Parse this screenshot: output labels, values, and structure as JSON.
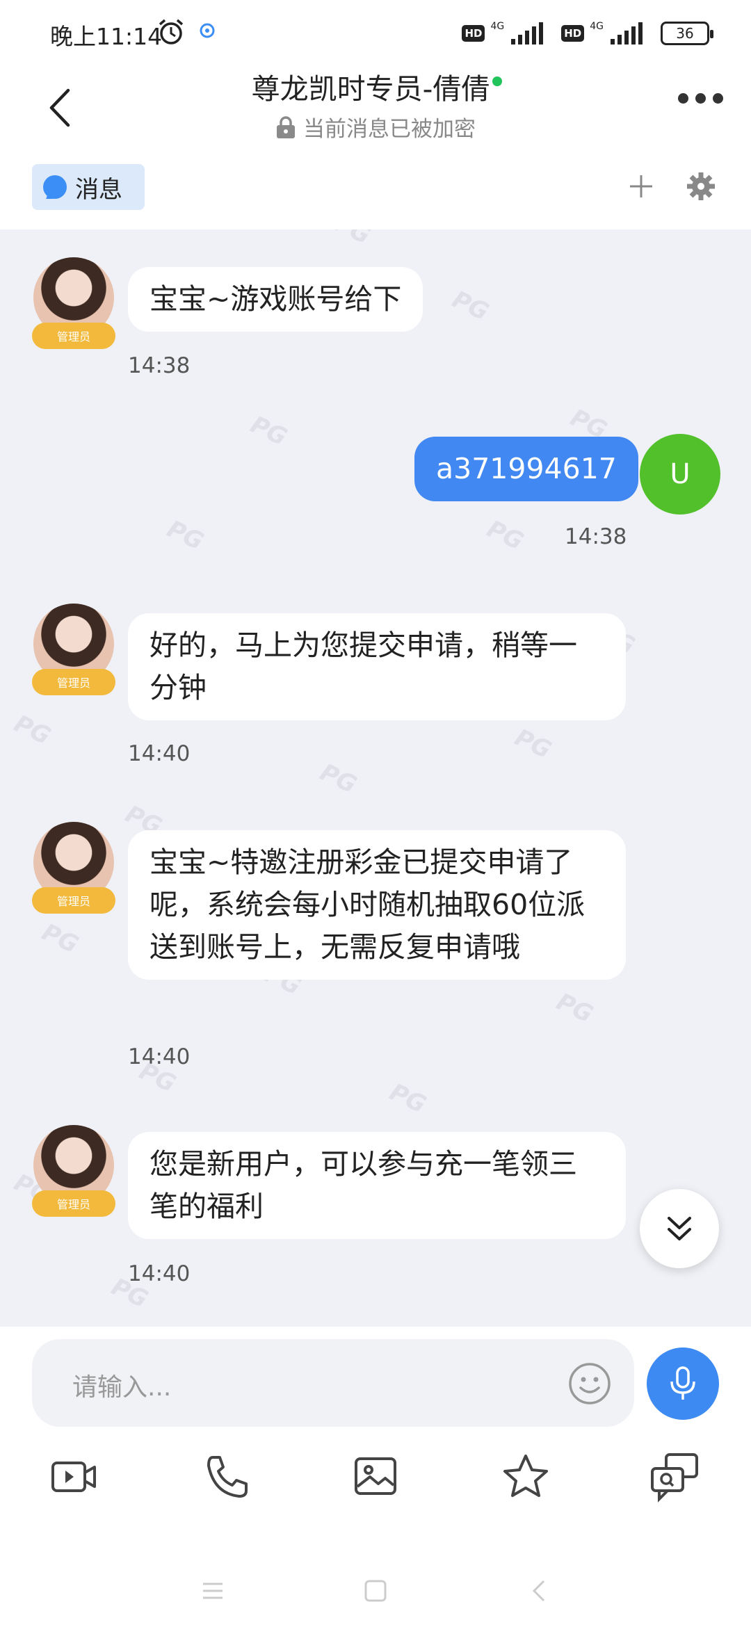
{
  "status_bar": {
    "time": "晚上11:14",
    "network_badge_1": "HD",
    "network_label_1": "4G",
    "network_badge_2": "HD",
    "network_label_2": "4G",
    "battery": "36"
  },
  "header": {
    "title": "尊龙凯时专员-倩倩",
    "subtitle": "当前消息已被加密",
    "online_color": "#21c45b"
  },
  "tabs": {
    "messages_label": "消息"
  },
  "messages": [
    {
      "sender": "admin",
      "badge": "管理员",
      "text": "宝宝~游戏账号给下",
      "time": "14:38"
    },
    {
      "sender": "user",
      "avatar_letter": "U",
      "text": "a371994617",
      "time": "14:38"
    },
    {
      "sender": "admin",
      "badge": "管理员",
      "text": "好的，马上为您提交申请，稍等一分钟",
      "time": "14:40"
    },
    {
      "sender": "admin",
      "badge": "管理员",
      "text": "宝宝~特邀注册彩金已提交申请了呢，系统会每小时随机抽取60位派送到账号上，无需反复申请哦",
      "time": "14:40"
    },
    {
      "sender": "admin",
      "badge": "管理员",
      "text": "您是新用户，可以参与充一笔领三笔的福利",
      "time": "14:40"
    }
  ],
  "input": {
    "placeholder": "请输入..."
  },
  "toolbar": {
    "items": [
      "video-icon",
      "phone-icon",
      "image-icon",
      "star-icon",
      "question-chat-icon"
    ]
  },
  "colors": {
    "accent": "#3d8af3",
    "sent_bubble": "#4188f2",
    "chat_bg": "#eff1f6",
    "badge": "#f2b93c",
    "user_avatar": "#52c02b"
  }
}
